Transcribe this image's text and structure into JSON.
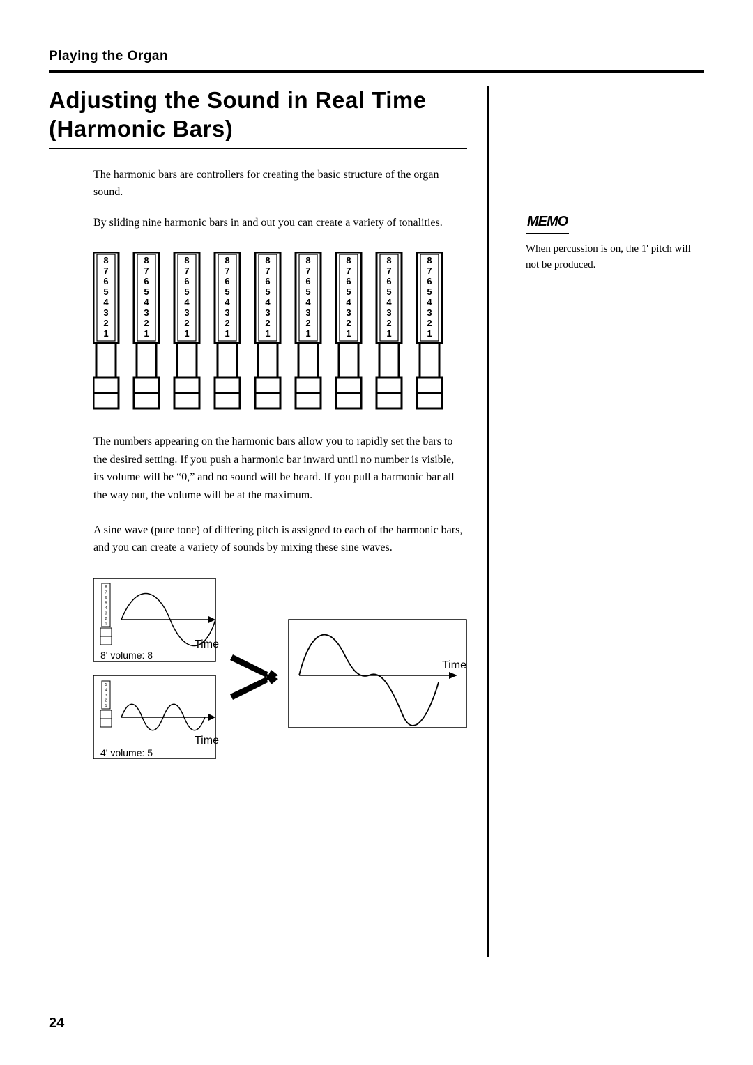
{
  "section_label": "Playing the Organ",
  "title": "Adjusting the Sound in Real Time (Harmonic Bars)",
  "para1": "The harmonic bars are controllers for creating the basic structure of the organ sound.",
  "para2": "By sliding nine harmonic bars in and out you can create a variety of tonalities.",
  "para3": "The numbers appearing on the harmonic bars allow you to rapidly set the bars to the desired setting. If you push a harmonic bar inward until no number is visible, its volume will be “0,” and no sound will be heard. If you pull a harmonic bar all the way out, the volume will be at the maximum.",
  "para4": "A sine wave (pure tone) of differing pitch is assigned to each of the harmonic bars, and you can create a variety of sounds by mixing these sine waves.",
  "memo_label": "MEMO",
  "memo_text": "When percussion is on, the 1' pitch will not be produced.",
  "page_number": "24",
  "bar_numbers": [
    "8",
    "7",
    "6",
    "5",
    "4",
    "3",
    "2",
    "1"
  ],
  "wave_a_label": "8' volume: 8",
  "wave_b_label": "4' volume: 5",
  "time_label": "Time",
  "small_bar_a_numbers": [
    "8",
    "7",
    "6",
    "5",
    "4",
    "3",
    "2",
    "1"
  ],
  "small_bar_b_numbers": [
    "5",
    "4",
    "3",
    "2",
    "1"
  ]
}
